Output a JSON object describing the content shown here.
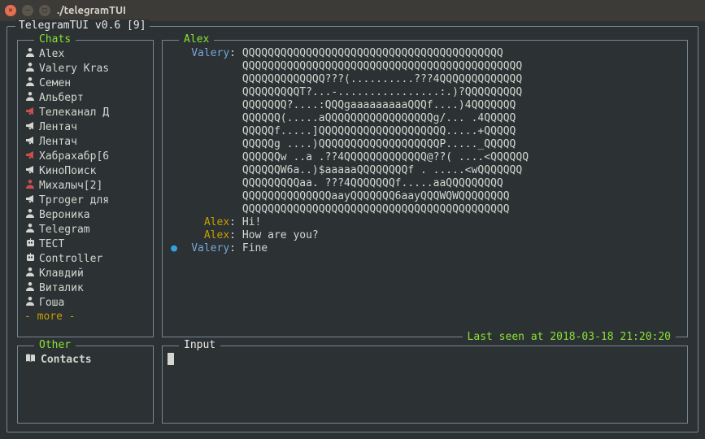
{
  "window": {
    "title": "./telegramTUI"
  },
  "app": {
    "header": "TelegramTUI v0.6 [9]"
  },
  "panels": {
    "chats_label": "Chats",
    "other_label": "Other",
    "input_label": "Input",
    "chat_label": "Alex"
  },
  "sidebar": {
    "items": [
      {
        "icon": "person",
        "label": "Alex"
      },
      {
        "icon": "person",
        "label": "Valery Kras"
      },
      {
        "icon": "person",
        "label": "Семен"
      },
      {
        "icon": "person",
        "label": "Альберт"
      },
      {
        "icon": "mega-red",
        "label": "Телеканал Д"
      },
      {
        "icon": "mega",
        "label": "Лентач"
      },
      {
        "icon": "mega",
        "label": "Лентач"
      },
      {
        "icon": "mega-red",
        "label": "Хабрахабр[6"
      },
      {
        "icon": "mega",
        "label": "КиноПоиск"
      },
      {
        "icon": "person-red",
        "label": "Михалыч[2]"
      },
      {
        "icon": "mega",
        "label": "Tproger для"
      },
      {
        "icon": "person",
        "label": "Вероника"
      },
      {
        "icon": "person",
        "label": "Telegram"
      },
      {
        "icon": "robot",
        "label": "ТЕСТ"
      },
      {
        "icon": "robot",
        "label": "Controller"
      },
      {
        "icon": "person",
        "label": "Клавдий"
      },
      {
        "icon": "person",
        "label": "Виталик"
      },
      {
        "icon": "person",
        "label": "Гоша"
      }
    ],
    "more": "- more -"
  },
  "other": {
    "items": [
      {
        "icon": "book",
        "label": "Contacts"
      }
    ]
  },
  "messages": [
    {
      "sender": "Valery",
      "senderClass": "valery",
      "dot": false,
      "lines": [
        "QQQQQQQQQQQQQQQQQQQQQQQQQQQQQQQQQQQQQQQQQ",
        "QQQQQQQQQQQQQQQQQQQQQQQQQQQQQQQQQQQQQQQQQQQQ",
        "QQQQQQQQQQQQQ???(..........???4QQQQQQQQQQQQQ",
        "QQQQQQQQQT?...-................:.)?QQQQQQQQQ",
        "QQQQQQQ?....:QQQgaaaaaaaaaQQQf....)4QQQQQQQ",
        "QQQQQQ(.....aQQQQQQQQQQQQQQQQQg/... .4QQQQQ",
        "QQQQQf.....]QQQQQQQQQQQQQQQQQQQQ.....+QQQQQ",
        "QQQQQg ....)QQQQQQQQQQQQQQQQQQQP....._QQQQQ",
        "QQQQQQw ..a .??4QQQQQQQQQQQQQ@??( ....<QQQQQQ",
        "QQQQQQW6a..)$aaaaaQQQQQQQQf . .....<wQQQQQQQ",
        "QQQQQQQQQaa. ???4QQQQQQQf.....aaQQQQQQQQQ",
        "QQQQQQQQQQQQQQaayQQQQQQQ6aayQQQWQWQQQQQQQQ",
        "QQQQQQQQQQQQQQQQQQQQQQQQQQQQQQQQQQQQQQQQQQ"
      ]
    },
    {
      "sender": "Alex",
      "senderClass": "alex",
      "dot": false,
      "lines": [
        "Hi!"
      ]
    },
    {
      "sender": "Alex",
      "senderClass": "alex",
      "dot": false,
      "lines": [
        "How are you?"
      ]
    },
    {
      "sender": "Valery",
      "senderClass": "valery",
      "dot": true,
      "lines": [
        "Fine"
      ]
    }
  ],
  "status": {
    "last_seen": "Last seen at 2018-03-18 21:20:20"
  },
  "icons": {
    "person": "♟",
    "person-red": "♟",
    "mega": "📢",
    "mega-red": "📢",
    "robot": "🤖",
    "book": "📖"
  }
}
